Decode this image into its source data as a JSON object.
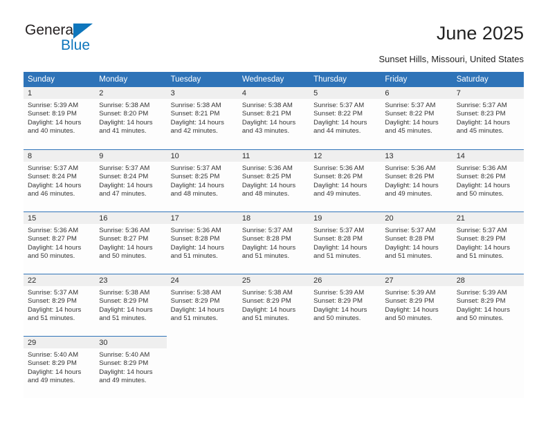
{
  "brand": {
    "name_top": "General",
    "name_bottom": "Blue",
    "accent_color": "#0e76bc"
  },
  "header": {
    "title": "June 2025",
    "subtitle": "Sunset Hills, Missouri, United States"
  },
  "calendar": {
    "header_color": "#2e73b8",
    "daynum_band_color": "#efefef",
    "weekdays": [
      "Sunday",
      "Monday",
      "Tuesday",
      "Wednesday",
      "Thursday",
      "Friday",
      "Saturday"
    ],
    "weeks": [
      [
        {
          "day": "1",
          "sunrise": "Sunrise: 5:39 AM",
          "sunset": "Sunset: 8:19 PM",
          "daylight": "Daylight: 14 hours and 40 minutes."
        },
        {
          "day": "2",
          "sunrise": "Sunrise: 5:38 AM",
          "sunset": "Sunset: 8:20 PM",
          "daylight": "Daylight: 14 hours and 41 minutes."
        },
        {
          "day": "3",
          "sunrise": "Sunrise: 5:38 AM",
          "sunset": "Sunset: 8:21 PM",
          "daylight": "Daylight: 14 hours and 42 minutes."
        },
        {
          "day": "4",
          "sunrise": "Sunrise: 5:38 AM",
          "sunset": "Sunset: 8:21 PM",
          "daylight": "Daylight: 14 hours and 43 minutes."
        },
        {
          "day": "5",
          "sunrise": "Sunrise: 5:37 AM",
          "sunset": "Sunset: 8:22 PM",
          "daylight": "Daylight: 14 hours and 44 minutes."
        },
        {
          "day": "6",
          "sunrise": "Sunrise: 5:37 AM",
          "sunset": "Sunset: 8:22 PM",
          "daylight": "Daylight: 14 hours and 45 minutes."
        },
        {
          "day": "7",
          "sunrise": "Sunrise: 5:37 AM",
          "sunset": "Sunset: 8:23 PM",
          "daylight": "Daylight: 14 hours and 45 minutes."
        }
      ],
      [
        {
          "day": "8",
          "sunrise": "Sunrise: 5:37 AM",
          "sunset": "Sunset: 8:24 PM",
          "daylight": "Daylight: 14 hours and 46 minutes."
        },
        {
          "day": "9",
          "sunrise": "Sunrise: 5:37 AM",
          "sunset": "Sunset: 8:24 PM",
          "daylight": "Daylight: 14 hours and 47 minutes."
        },
        {
          "day": "10",
          "sunrise": "Sunrise: 5:37 AM",
          "sunset": "Sunset: 8:25 PM",
          "daylight": "Daylight: 14 hours and 48 minutes."
        },
        {
          "day": "11",
          "sunrise": "Sunrise: 5:36 AM",
          "sunset": "Sunset: 8:25 PM",
          "daylight": "Daylight: 14 hours and 48 minutes."
        },
        {
          "day": "12",
          "sunrise": "Sunrise: 5:36 AM",
          "sunset": "Sunset: 8:26 PM",
          "daylight": "Daylight: 14 hours and 49 minutes."
        },
        {
          "day": "13",
          "sunrise": "Sunrise: 5:36 AM",
          "sunset": "Sunset: 8:26 PM",
          "daylight": "Daylight: 14 hours and 49 minutes."
        },
        {
          "day": "14",
          "sunrise": "Sunrise: 5:36 AM",
          "sunset": "Sunset: 8:26 PM",
          "daylight": "Daylight: 14 hours and 50 minutes."
        }
      ],
      [
        {
          "day": "15",
          "sunrise": "Sunrise: 5:36 AM",
          "sunset": "Sunset: 8:27 PM",
          "daylight": "Daylight: 14 hours and 50 minutes."
        },
        {
          "day": "16",
          "sunrise": "Sunrise: 5:36 AM",
          "sunset": "Sunset: 8:27 PM",
          "daylight": "Daylight: 14 hours and 50 minutes."
        },
        {
          "day": "17",
          "sunrise": "Sunrise: 5:36 AM",
          "sunset": "Sunset: 8:28 PM",
          "daylight": "Daylight: 14 hours and 51 minutes."
        },
        {
          "day": "18",
          "sunrise": "Sunrise: 5:37 AM",
          "sunset": "Sunset: 8:28 PM",
          "daylight": "Daylight: 14 hours and 51 minutes."
        },
        {
          "day": "19",
          "sunrise": "Sunrise: 5:37 AM",
          "sunset": "Sunset: 8:28 PM",
          "daylight": "Daylight: 14 hours and 51 minutes."
        },
        {
          "day": "20",
          "sunrise": "Sunrise: 5:37 AM",
          "sunset": "Sunset: 8:28 PM",
          "daylight": "Daylight: 14 hours and 51 minutes."
        },
        {
          "day": "21",
          "sunrise": "Sunrise: 5:37 AM",
          "sunset": "Sunset: 8:29 PM",
          "daylight": "Daylight: 14 hours and 51 minutes."
        }
      ],
      [
        {
          "day": "22",
          "sunrise": "Sunrise: 5:37 AM",
          "sunset": "Sunset: 8:29 PM",
          "daylight": "Daylight: 14 hours and 51 minutes."
        },
        {
          "day": "23",
          "sunrise": "Sunrise: 5:38 AM",
          "sunset": "Sunset: 8:29 PM",
          "daylight": "Daylight: 14 hours and 51 minutes."
        },
        {
          "day": "24",
          "sunrise": "Sunrise: 5:38 AM",
          "sunset": "Sunset: 8:29 PM",
          "daylight": "Daylight: 14 hours and 51 minutes."
        },
        {
          "day": "25",
          "sunrise": "Sunrise: 5:38 AM",
          "sunset": "Sunset: 8:29 PM",
          "daylight": "Daylight: 14 hours and 51 minutes."
        },
        {
          "day": "26",
          "sunrise": "Sunrise: 5:39 AM",
          "sunset": "Sunset: 8:29 PM",
          "daylight": "Daylight: 14 hours and 50 minutes."
        },
        {
          "day": "27",
          "sunrise": "Sunrise: 5:39 AM",
          "sunset": "Sunset: 8:29 PM",
          "daylight": "Daylight: 14 hours and 50 minutes."
        },
        {
          "day": "28",
          "sunrise": "Sunrise: 5:39 AM",
          "sunset": "Sunset: 8:29 PM",
          "daylight": "Daylight: 14 hours and 50 minutes."
        }
      ],
      [
        {
          "day": "29",
          "sunrise": "Sunrise: 5:40 AM",
          "sunset": "Sunset: 8:29 PM",
          "daylight": "Daylight: 14 hours and 49 minutes."
        },
        {
          "day": "30",
          "sunrise": "Sunrise: 5:40 AM",
          "sunset": "Sunset: 8:29 PM",
          "daylight": "Daylight: 14 hours and 49 minutes."
        },
        {
          "day": "",
          "sunrise": "",
          "sunset": "",
          "daylight": ""
        },
        {
          "day": "",
          "sunrise": "",
          "sunset": "",
          "daylight": ""
        },
        {
          "day": "",
          "sunrise": "",
          "sunset": "",
          "daylight": ""
        },
        {
          "day": "",
          "sunrise": "",
          "sunset": "",
          "daylight": ""
        },
        {
          "day": "",
          "sunrise": "",
          "sunset": "",
          "daylight": ""
        }
      ]
    ]
  }
}
